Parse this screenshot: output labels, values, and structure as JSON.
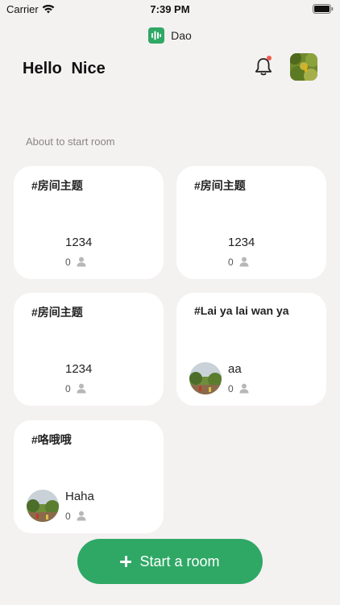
{
  "status_bar": {
    "carrier": "Carrier",
    "time": "7:39 PM"
  },
  "app": {
    "name": "Dao",
    "brand_color": "#2fa866"
  },
  "header": {
    "greeting": "Hello  Nice",
    "notification_dot_color": "#ef5a4d"
  },
  "section": {
    "title": "About to start room"
  },
  "rooms": [
    {
      "topic": "#房间主题",
      "host": "1234",
      "count": "0",
      "has_avatar": false
    },
    {
      "topic": "#房间主题",
      "host": "1234",
      "count": "0",
      "has_avatar": false
    },
    {
      "topic": "#房间主题",
      "host": "1234",
      "count": "0",
      "has_avatar": false
    },
    {
      "topic": "#Lai ya lai wan ya",
      "host": "aa",
      "count": "0",
      "has_avatar": true
    },
    {
      "topic": "#咯哦哦",
      "host": "Haha",
      "count": "0",
      "has_avatar": true
    }
  ],
  "actions": {
    "start_room_label": "Start a room"
  },
  "icons": {
    "wifi": "wifi-icon",
    "battery": "battery-icon",
    "logo": "waveform-icon",
    "bell": "bell-icon",
    "person": "person-icon",
    "plus": "plus-icon"
  }
}
